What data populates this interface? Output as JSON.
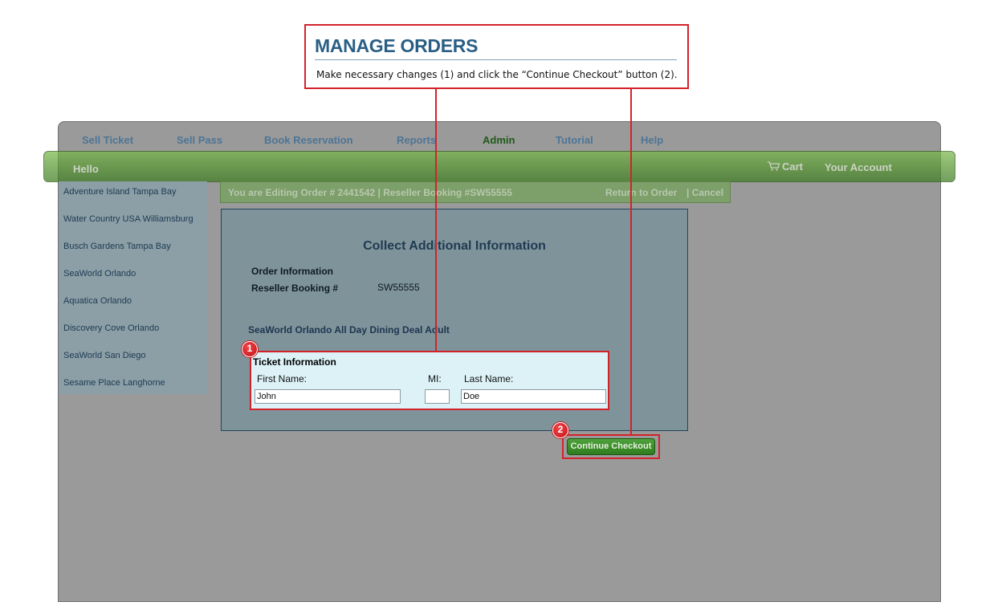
{
  "callout": {
    "title": "MANAGE ORDERS",
    "text": "Make necessary changes (1) and click the “Continue Checkout” button (2)."
  },
  "nav": {
    "items": [
      "Sell Ticket",
      "Sell Pass",
      "Book Reservation",
      "Reports",
      "Admin",
      "Tutorial",
      "Help"
    ],
    "active": "Admin"
  },
  "greenbar": {
    "hello": "Hello",
    "cart": "Cart",
    "account": "Your Account"
  },
  "sidebar": {
    "items": [
      "Adventure Island Tampa Bay",
      "Water Country USA Williamsburg",
      "Busch Gardens Tampa Bay",
      "SeaWorld Orlando",
      "Aquatica Orlando",
      "Discovery Cove Orlando",
      "SeaWorld San Diego",
      "Sesame Place Langhorne"
    ]
  },
  "editbar": {
    "status": "You are Editing Order # 2441542  |  Reseller Booking #SW55555",
    "return_link": "Return to Order",
    "cancel_link": "| Cancel"
  },
  "panel": {
    "title": "Collect Additional Information",
    "order_info_label": "Order Information",
    "reseller_label": "Reseller Booking #",
    "reseller_value": "SW55555",
    "product": "SeaWorld Orlando All Day Dining Deal Adult"
  },
  "ticket": {
    "title": "Ticket Information",
    "first_name_label": "First Name:",
    "mi_label": "MI:",
    "last_name_label": "Last Name:",
    "first_name_value": "John",
    "mi_value": "",
    "last_name_value": "Doe"
  },
  "badges": {
    "one": "1",
    "two": "2"
  },
  "button": {
    "continue_label": "Continue Checkout"
  },
  "colors": {
    "callout_border": "#d3232a",
    "title_blue": "#2a5f85",
    "nav_active": "#1f5a18",
    "green_bar": "#5b9c35"
  }
}
